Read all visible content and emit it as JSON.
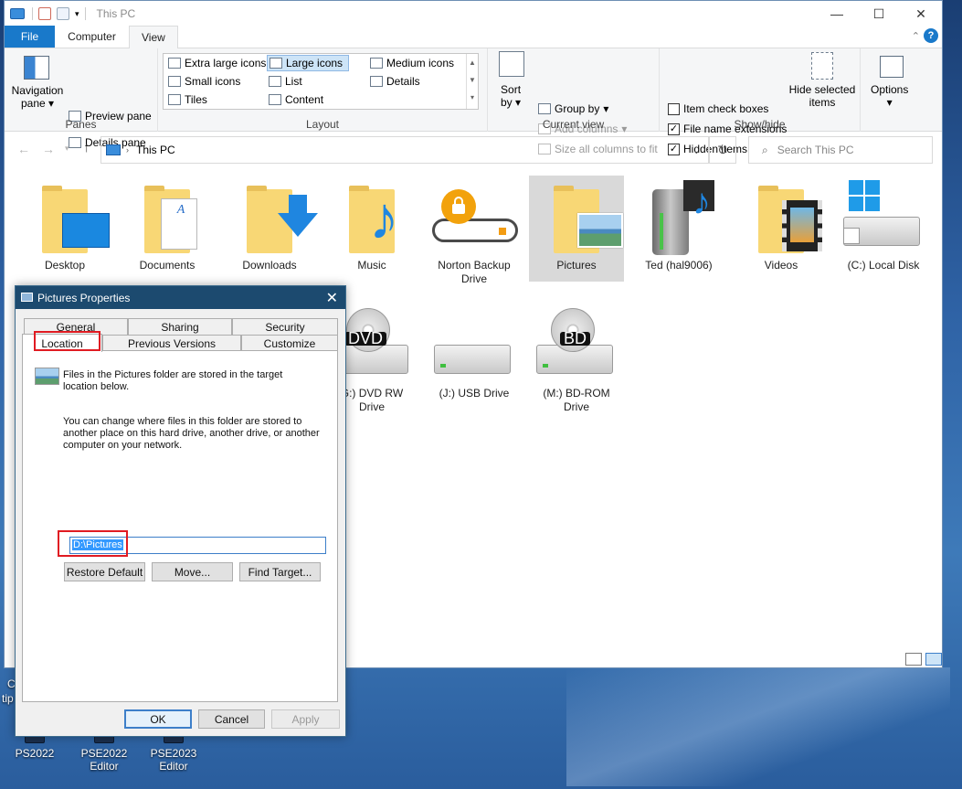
{
  "window": {
    "title": "This PC",
    "controls": {
      "minimize": "—",
      "maximize": "☐",
      "close": "✕"
    }
  },
  "ribbon_tabs": [
    "File",
    "Computer",
    "View"
  ],
  "ribbon": {
    "panes": {
      "navigation_pane_line1": "Navigation",
      "navigation_pane_line2": "pane",
      "preview_pane": "Preview pane",
      "details_pane": "Details pane",
      "group_label": "Panes"
    },
    "layout": {
      "options": [
        "Extra large icons",
        "Large icons",
        "Medium icons",
        "Small icons",
        "List",
        "Details",
        "Tiles",
        "Content"
      ],
      "selected": "Large icons",
      "group_label": "Layout"
    },
    "current_view": {
      "sort_line1": "Sort",
      "sort_line2": "by",
      "group_by": "Group by",
      "add_columns": "Add columns",
      "size_all_columns": "Size all columns to fit",
      "group_label": "Current view"
    },
    "show_hide": {
      "item_check_boxes": "Item check boxes",
      "item_check_boxes_checked": false,
      "file_name_extensions": "File name extensions",
      "file_name_extensions_checked": true,
      "hidden_items": "Hidden items",
      "hidden_items_checked": true,
      "hide_selected_line1": "Hide selected",
      "hide_selected_line2": "items",
      "group_label": "Show/hide"
    },
    "options": "Options"
  },
  "address": {
    "path": "This PC",
    "search_placeholder": "Search This PC"
  },
  "items": [
    {
      "label": "Desktop"
    },
    {
      "label": "Documents"
    },
    {
      "label": "Downloads"
    },
    {
      "label": "Music"
    },
    {
      "label": "Norton Backup Drive"
    },
    {
      "label": "Pictures",
      "selected": true
    },
    {
      "label": "Ted (hal9006)"
    },
    {
      "label": "Videos"
    },
    {
      "label": "(C:) Local Disk"
    },
    {
      "label": "(G:) DVD RW Drive",
      "visible_line1": "G:) DVD RW",
      "visible_line2": "Drive"
    },
    {
      "label": "(J:) USB Drive"
    },
    {
      "label": "(M:) BD-ROM Drive",
      "line1": "(M:) BD-ROM",
      "line2": "Drive"
    }
  ],
  "dialog": {
    "title": "Pictures Properties",
    "tabs_row1": [
      "General",
      "Sharing",
      "Security"
    ],
    "tabs_row2": [
      "Location",
      "Previous Versions",
      "Customize"
    ],
    "active_tab": "Location",
    "info_text": "Files in the Pictures folder are stored in the target location below.",
    "info_line1": "Files in the Pictures folder are stored in the target",
    "info_line2": "location below.",
    "change_line1": "You can change where files in this folder are stored to",
    "change_line2": "another place on this hard drive, another drive, or another",
    "change_line3": "computer on your network.",
    "path_value": "D:\\Pictures",
    "buttons": {
      "restore_default": "Restore Default",
      "move": "Move...",
      "find_target": "Find Target..."
    },
    "footer": {
      "ok": "OK",
      "cancel": "Cancel",
      "apply": "Apply"
    }
  },
  "desktop_icons": [
    "PS2022",
    "PSE2022 Editor",
    "PSE2023 Editor"
  ],
  "desktop_icons_lines": {
    "pse2022_1": "PSE2022",
    "pse2022_2": "Editor",
    "pse2023_1": "PSE2023",
    "pse2023_2": "Editor"
  },
  "desktop_cut_text": {
    "line1": "C",
    "line2": "tip"
  },
  "colors": {
    "file_tab": "#1979ca",
    "dialog_title": "#1c4a6f",
    "highlight_red": "#e01b22",
    "selection": "#3399ff"
  }
}
